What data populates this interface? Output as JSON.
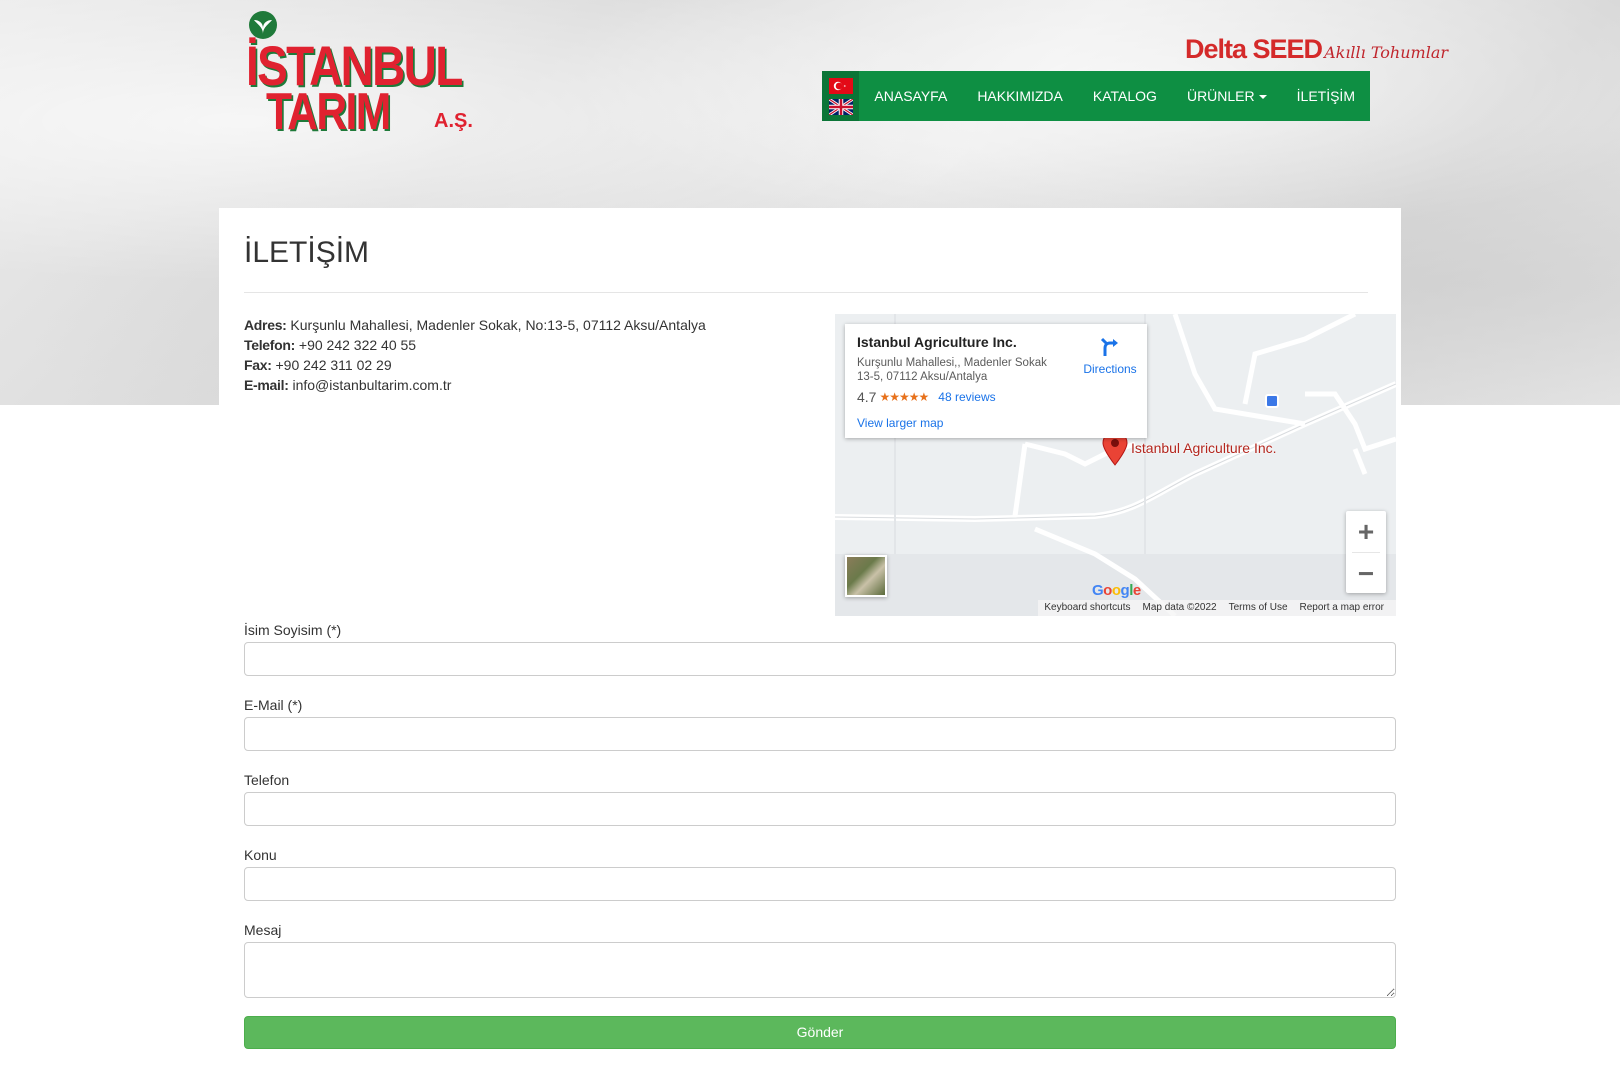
{
  "header": {
    "logo_text_line1": "İSTANBUL",
    "logo_text_line2": "TARIM",
    "logo_text_suffix": "A.Ş.",
    "delta_brand": "Delta SEED",
    "delta_tagline": "Akıllı Tohumlar"
  },
  "nav": {
    "flags": [
      "turkey-flag-icon",
      "uk-flag-icon"
    ],
    "items": [
      {
        "label": "ANASAYFA"
      },
      {
        "label": "HAKKIMIZDA"
      },
      {
        "label": "KATALOG"
      },
      {
        "label": "ÜRÜNLER"
      },
      {
        "label": "İLETİŞİM"
      }
    ],
    "color": "#0e8f43"
  },
  "page": {
    "title": "İLETİŞİM"
  },
  "contact": {
    "address_label": "Adres:",
    "address_value": " Kurşunlu Mahallesi, Madenler Sokak, No:13-5, 07112 Aksu/Antalya",
    "phone_label": "Telefon:",
    "phone_value": " +90 242 322 40 55",
    "fax_label": "Fax:",
    "fax_value": " +90 242 311 02 29",
    "email_label": "E-mail:",
    "email_value": " info@istanbultarim.com.tr"
  },
  "map": {
    "place_name": "Istanbul Agriculture Inc.",
    "place_address": "Kurşunlu Mahallesi,, Madenler Sokak 13-5, 07112 Aksu/Antalya",
    "rating": "4.7",
    "stars": "★★★★★",
    "reviews": "48 reviews",
    "view_larger": "View larger map",
    "directions": "Directions",
    "pin_label": "Istanbul Agriculture Inc.",
    "zoom_in": "+",
    "zoom_out": "−",
    "google_logo": "Google",
    "attribution": [
      "Keyboard shortcuts",
      "Map data ©2022",
      "Terms of Use",
      "Report a map error"
    ]
  },
  "form": {
    "name_label": "İsim Soyisim (*)",
    "email_label": "E-Mail (*)",
    "phone_label": "Telefon",
    "subject_label": "Konu",
    "message_label": "Mesaj",
    "submit_label": "Gönder",
    "submit_color": "#5cb85c"
  }
}
